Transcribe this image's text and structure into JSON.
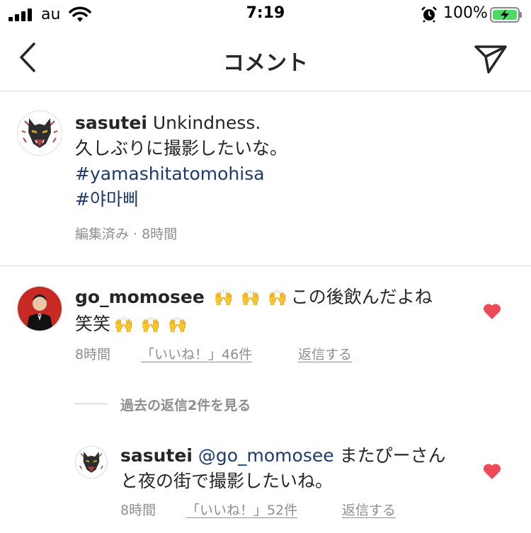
{
  "status_bar": {
    "carrier": "au",
    "time": "7:19",
    "battery": "100%"
  },
  "nav": {
    "title": "コメント"
  },
  "caption": {
    "username": "sasutei",
    "text_line1": "Unkindness.",
    "text_line2": "久しぶりに撮影したいな。",
    "hashtag1": "#yamashitatomohisa",
    "hashtag2": "#야마삐",
    "meta": "編集済み · 8時間"
  },
  "comments": [
    {
      "username": "go_momosee",
      "text_line1": "この後飲んだよね",
      "text_line2": "笑笑",
      "clap_emoji": "🙌",
      "time": "8時間",
      "likes": "「いいね！」46件",
      "reply": "返信する",
      "liked": true,
      "heart_color": "#ed4956"
    }
  ],
  "view_replies": "過去の返信2件を見る",
  "reply": {
    "username": "sasutei",
    "mention": "@go_momosee",
    "text_line1": "またぴーさん",
    "text_line2": "と夜の街で撮影したいね。",
    "time": "8時間",
    "likes": "「いいね！」52件",
    "reply": "返信する",
    "liked": true
  },
  "icons": {
    "back": "chevron-left-icon",
    "send": "paper-plane-icon",
    "heart": "heart-icon",
    "wifi": "wifi-icon",
    "alarm": "alarm-icon",
    "battery": "battery-charging-icon"
  }
}
